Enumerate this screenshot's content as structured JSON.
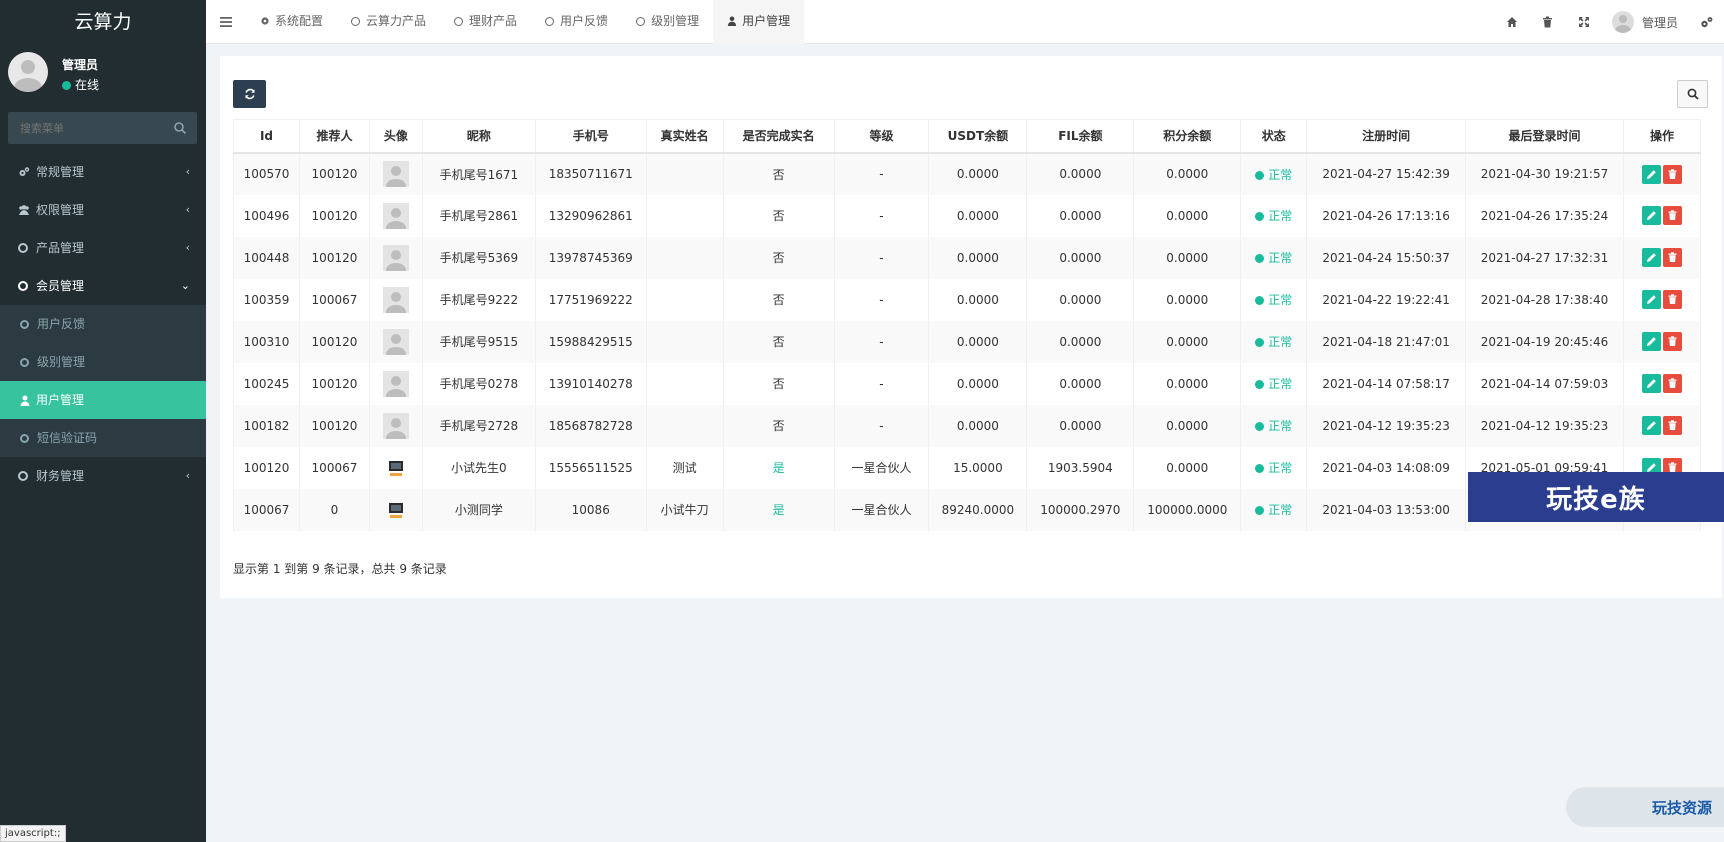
{
  "app": {
    "brand": "云算力",
    "user_name": "管理员",
    "user_status": "在线",
    "search_placeholder": "搜索菜单"
  },
  "sidebar": {
    "items": [
      {
        "label": "常规管理"
      },
      {
        "label": "权限管理"
      },
      {
        "label": "产品管理"
      },
      {
        "label": "会员管理"
      },
      {
        "label": "财务管理"
      }
    ],
    "sub_items": [
      {
        "label": "用户反馈"
      },
      {
        "label": "级别管理"
      },
      {
        "label": "用户管理"
      },
      {
        "label": "短信验证码"
      }
    ]
  },
  "topnav": {
    "tabs": [
      {
        "label": "系统配置"
      },
      {
        "label": "云算力产品"
      },
      {
        "label": "理财产品"
      },
      {
        "label": "用户反馈"
      },
      {
        "label": "级别管理"
      },
      {
        "label": "用户管理"
      }
    ],
    "user_label": "管理员"
  },
  "table": {
    "headers": [
      "Id",
      "推荐人",
      "头像",
      "昵称",
      "手机号",
      "真实姓名",
      "是否完成实名",
      "等级",
      "USDT余额",
      "FIL余额",
      "积分余额",
      "状态",
      "注册时间",
      "最后登录时间",
      "操作"
    ],
    "rows": [
      [
        "100570",
        "100120",
        "",
        "手机尾号1671",
        "18350711671",
        "",
        "否",
        "-",
        "0.0000",
        "0.0000",
        "0.0000",
        "正常",
        "2021-04-27 15:42:39",
        "2021-04-30 19:21:57"
      ],
      [
        "100496",
        "100120",
        "",
        "手机尾号2861",
        "13290962861",
        "",
        "否",
        "-",
        "0.0000",
        "0.0000",
        "0.0000",
        "正常",
        "2021-04-26 17:13:16",
        "2021-04-26 17:35:24"
      ],
      [
        "100448",
        "100120",
        "",
        "手机尾号5369",
        "13978745369",
        "",
        "否",
        "-",
        "0.0000",
        "0.0000",
        "0.0000",
        "正常",
        "2021-04-24 15:50:37",
        "2021-04-27 17:32:31"
      ],
      [
        "100359",
        "100067",
        "",
        "手机尾号9222",
        "17751969222",
        "",
        "否",
        "-",
        "0.0000",
        "0.0000",
        "0.0000",
        "正常",
        "2021-04-22 19:22:41",
        "2021-04-28 17:38:40"
      ],
      [
        "100310",
        "100120",
        "",
        "手机尾号9515",
        "15988429515",
        "",
        "否",
        "-",
        "0.0000",
        "0.0000",
        "0.0000",
        "正常",
        "2021-04-18 21:47:01",
        "2021-04-19 20:45:46"
      ],
      [
        "100245",
        "100120",
        "",
        "手机尾号0278",
        "13910140278",
        "",
        "否",
        "-",
        "0.0000",
        "0.0000",
        "0.0000",
        "正常",
        "2021-04-14 07:58:17",
        "2021-04-14 07:59:03"
      ],
      [
        "100182",
        "100120",
        "",
        "手机尾号2728",
        "18568782728",
        "",
        "否",
        "-",
        "0.0000",
        "0.0000",
        "0.0000",
        "正常",
        "2021-04-12 19:35:23",
        "2021-04-12 19:35:23"
      ],
      [
        "100120",
        "100067",
        "",
        "小试先生0",
        "15556511525",
        "测试",
        "是",
        "一星合伙人",
        "15.0000",
        "1903.5904",
        "0.0000",
        "正常",
        "2021-04-03 14:08:09",
        "2021-05-01 09:59:41"
      ],
      [
        "100067",
        "0",
        "",
        "小测同学",
        "10086",
        "小试牛刀",
        "是",
        "一星合伙人",
        "89240.0000",
        "100000.2970",
        "100000.0000",
        "正常",
        "2021-04-03 13:53:00",
        ""
      ]
    ],
    "pager": "显示第 1 到第 9 条记录，总共 9 条记录"
  },
  "overlays": {
    "watermark_main": "玩技e族",
    "watermark_corner": "玩技资源",
    "statusbar": "javascript:;"
  },
  "colors": {
    "sidebar_bg": "#222d32",
    "accent": "#18bc9c",
    "active_menu": "#36c39e",
    "danger": "#e74c3c",
    "dark_button": "#2c3e50"
  }
}
